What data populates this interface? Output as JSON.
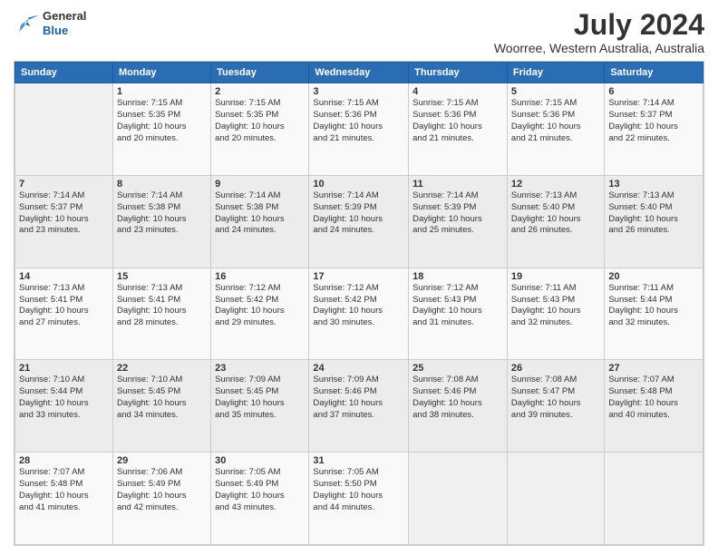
{
  "header": {
    "logo_line1": "General",
    "logo_line2": "Blue",
    "month_year": "July 2024",
    "location": "Woorree, Western Australia, Australia"
  },
  "days_of_week": [
    "Sunday",
    "Monday",
    "Tuesday",
    "Wednesday",
    "Thursday",
    "Friday",
    "Saturday"
  ],
  "weeks": [
    [
      {
        "day": "",
        "info": ""
      },
      {
        "day": "1",
        "info": "Sunrise: 7:15 AM\nSunset: 5:35 PM\nDaylight: 10 hours\nand 20 minutes."
      },
      {
        "day": "2",
        "info": "Sunrise: 7:15 AM\nSunset: 5:35 PM\nDaylight: 10 hours\nand 20 minutes."
      },
      {
        "day": "3",
        "info": "Sunrise: 7:15 AM\nSunset: 5:36 PM\nDaylight: 10 hours\nand 21 minutes."
      },
      {
        "day": "4",
        "info": "Sunrise: 7:15 AM\nSunset: 5:36 PM\nDaylight: 10 hours\nand 21 minutes."
      },
      {
        "day": "5",
        "info": "Sunrise: 7:15 AM\nSunset: 5:36 PM\nDaylight: 10 hours\nand 21 minutes."
      },
      {
        "day": "6",
        "info": "Sunrise: 7:14 AM\nSunset: 5:37 PM\nDaylight: 10 hours\nand 22 minutes."
      }
    ],
    [
      {
        "day": "7",
        "info": "Sunrise: 7:14 AM\nSunset: 5:37 PM\nDaylight: 10 hours\nand 23 minutes."
      },
      {
        "day": "8",
        "info": "Sunrise: 7:14 AM\nSunset: 5:38 PM\nDaylight: 10 hours\nand 23 minutes."
      },
      {
        "day": "9",
        "info": "Sunrise: 7:14 AM\nSunset: 5:38 PM\nDaylight: 10 hours\nand 24 minutes."
      },
      {
        "day": "10",
        "info": "Sunrise: 7:14 AM\nSunset: 5:39 PM\nDaylight: 10 hours\nand 24 minutes."
      },
      {
        "day": "11",
        "info": "Sunrise: 7:14 AM\nSunset: 5:39 PM\nDaylight: 10 hours\nand 25 minutes."
      },
      {
        "day": "12",
        "info": "Sunrise: 7:13 AM\nSunset: 5:40 PM\nDaylight: 10 hours\nand 26 minutes."
      },
      {
        "day": "13",
        "info": "Sunrise: 7:13 AM\nSunset: 5:40 PM\nDaylight: 10 hours\nand 26 minutes."
      }
    ],
    [
      {
        "day": "14",
        "info": "Sunrise: 7:13 AM\nSunset: 5:41 PM\nDaylight: 10 hours\nand 27 minutes."
      },
      {
        "day": "15",
        "info": "Sunrise: 7:13 AM\nSunset: 5:41 PM\nDaylight: 10 hours\nand 28 minutes."
      },
      {
        "day": "16",
        "info": "Sunrise: 7:12 AM\nSunset: 5:42 PM\nDaylight: 10 hours\nand 29 minutes."
      },
      {
        "day": "17",
        "info": "Sunrise: 7:12 AM\nSunset: 5:42 PM\nDaylight: 10 hours\nand 30 minutes."
      },
      {
        "day": "18",
        "info": "Sunrise: 7:12 AM\nSunset: 5:43 PM\nDaylight: 10 hours\nand 31 minutes."
      },
      {
        "day": "19",
        "info": "Sunrise: 7:11 AM\nSunset: 5:43 PM\nDaylight: 10 hours\nand 32 minutes."
      },
      {
        "day": "20",
        "info": "Sunrise: 7:11 AM\nSunset: 5:44 PM\nDaylight: 10 hours\nand 32 minutes."
      }
    ],
    [
      {
        "day": "21",
        "info": "Sunrise: 7:10 AM\nSunset: 5:44 PM\nDaylight: 10 hours\nand 33 minutes."
      },
      {
        "day": "22",
        "info": "Sunrise: 7:10 AM\nSunset: 5:45 PM\nDaylight: 10 hours\nand 34 minutes."
      },
      {
        "day": "23",
        "info": "Sunrise: 7:09 AM\nSunset: 5:45 PM\nDaylight: 10 hours\nand 35 minutes."
      },
      {
        "day": "24",
        "info": "Sunrise: 7:09 AM\nSunset: 5:46 PM\nDaylight: 10 hours\nand 37 minutes."
      },
      {
        "day": "25",
        "info": "Sunrise: 7:08 AM\nSunset: 5:46 PM\nDaylight: 10 hours\nand 38 minutes."
      },
      {
        "day": "26",
        "info": "Sunrise: 7:08 AM\nSunset: 5:47 PM\nDaylight: 10 hours\nand 39 minutes."
      },
      {
        "day": "27",
        "info": "Sunrise: 7:07 AM\nSunset: 5:48 PM\nDaylight: 10 hours\nand 40 minutes."
      }
    ],
    [
      {
        "day": "28",
        "info": "Sunrise: 7:07 AM\nSunset: 5:48 PM\nDaylight: 10 hours\nand 41 minutes."
      },
      {
        "day": "29",
        "info": "Sunrise: 7:06 AM\nSunset: 5:49 PM\nDaylight: 10 hours\nand 42 minutes."
      },
      {
        "day": "30",
        "info": "Sunrise: 7:05 AM\nSunset: 5:49 PM\nDaylight: 10 hours\nand 43 minutes."
      },
      {
        "day": "31",
        "info": "Sunrise: 7:05 AM\nSunset: 5:50 PM\nDaylight: 10 hours\nand 44 minutes."
      },
      {
        "day": "",
        "info": ""
      },
      {
        "day": "",
        "info": ""
      },
      {
        "day": "",
        "info": ""
      }
    ]
  ]
}
